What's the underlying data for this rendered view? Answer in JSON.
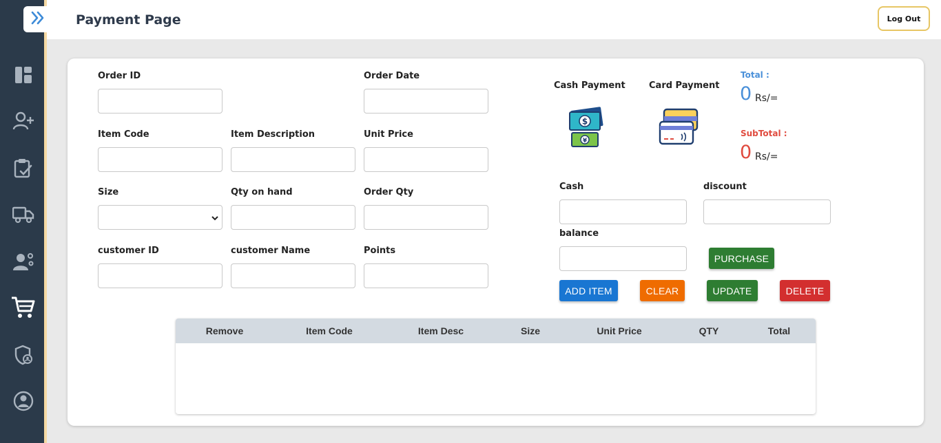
{
  "header": {
    "title": "Payment Page",
    "logout_label": "Log Out"
  },
  "sidebar": {
    "toggle_icon": "double-chevron-right-icon",
    "items": [
      {
        "icon": "dashboard-icon"
      },
      {
        "icon": "add-user-icon"
      },
      {
        "icon": "clipboard-check-icon"
      },
      {
        "icon": "truck-icon"
      },
      {
        "icon": "user-gear-icon"
      },
      {
        "icon": "cart-icon",
        "active": true
      },
      {
        "icon": "shield-user-icon"
      },
      {
        "icon": "account-circle-icon"
      }
    ]
  },
  "form": {
    "order_id": {
      "label": "Order ID",
      "value": ""
    },
    "order_date": {
      "label": "Order Date",
      "value": ""
    },
    "item_code": {
      "label": "Item Code",
      "value": ""
    },
    "item_description": {
      "label": "Item Description",
      "value": ""
    },
    "unit_price": {
      "label": "Unit Price",
      "value": ""
    },
    "size": {
      "label": "Size",
      "value": ""
    },
    "qty_on_hand": {
      "label": "Qty on hand",
      "value": ""
    },
    "order_qty": {
      "label": "Order Qty",
      "value": ""
    },
    "customer_id": {
      "label": "customer ID",
      "value": ""
    },
    "customer_name": {
      "label": "customer Name",
      "value": ""
    },
    "points": {
      "label": "Points",
      "value": ""
    }
  },
  "payment": {
    "cash_label": "Cash Payment",
    "card_label": "Card Payment",
    "total_label": "Total :",
    "total_value": "0",
    "subtotal_label": "SubTotal :",
    "subtotal_value": "0",
    "unit": "Rs/=",
    "cash": {
      "label": "Cash",
      "value": ""
    },
    "discount": {
      "label": "discount",
      "value": ""
    },
    "balance": {
      "label": "balance",
      "value": ""
    },
    "colors": {
      "total": "#4a90d9",
      "subtotal": "#e04b3f"
    }
  },
  "buttons": {
    "purchase": "PURCHASE",
    "add_item": "ADD ITEM",
    "clear": "CLEAR",
    "update": "UPDATE",
    "delete": "DELETE",
    "colors": {
      "purchase": "#2e7d32",
      "add_item": "#1976d2",
      "clear": "#ef6c00",
      "update": "#2e7d32",
      "delete": "#d32f2f"
    }
  },
  "table": {
    "columns": [
      "Remove",
      "Item Code",
      "Item Desc",
      "Size",
      "Unit Price",
      "QTY",
      "Total"
    ],
    "rows": []
  }
}
